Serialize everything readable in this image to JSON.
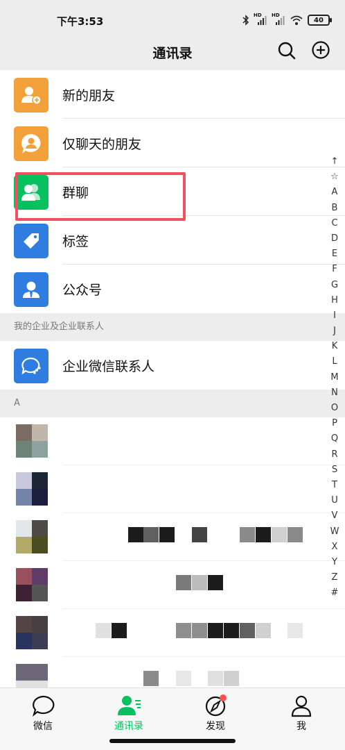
{
  "status_bar": {
    "time": "下午3:53",
    "battery": "40",
    "signal_labels": [
      "HD",
      "HD"
    ]
  },
  "header": {
    "title": "通讯录",
    "search_icon": "search-icon",
    "add_icon": "plus-circle-icon"
  },
  "entries": [
    {
      "label": "新的朋友",
      "icon": "add-friend-icon",
      "color": "#f2a13a"
    },
    {
      "label": "仅聊天的朋友",
      "icon": "chat-only-icon",
      "color": "#f2a13a"
    },
    {
      "label": "群聊",
      "icon": "group-chat-icon",
      "color": "#07c160"
    },
    {
      "label": "标签",
      "icon": "tag-icon",
      "color": "#2f7de1"
    },
    {
      "label": "公众号",
      "icon": "official-account-icon",
      "color": "#2f7de1"
    }
  ],
  "enterprise_section": {
    "header": "我的企业及企业联系人",
    "item_label": "企业微信联系人",
    "item_icon": "enterprise-wechat-icon",
    "color": "#2f7de1"
  },
  "contacts_section": {
    "header": "A",
    "contacts": [
      {
        "avatar_colors": [
          "#7a6c63",
          "#c0b6aa",
          "#6c8478",
          "#8ba39c"
        ]
      },
      {
        "avatar_colors": [
          "#c9c9de",
          "#1c2634",
          "#7385a8",
          "#1b1e3c"
        ]
      },
      {
        "avatar_colors": [
          "#e0e8ec",
          "#4c4c44",
          "#b4aa68",
          "#4c4c22"
        ]
      },
      {
        "avatar_colors": [
          "#98505c",
          "#603c68",
          "#402034",
          "#545454"
        ]
      },
      {
        "avatar_colors": [
          "#544444",
          "#484040",
          "#283460",
          "#3c3c54"
        ]
      },
      {
        "avatar_colors": [
          "#6c6878",
          "#6c6878",
          "#e0e0e0",
          "#e0e0e0"
        ]
      }
    ]
  },
  "alphabet_index": [
    "↑",
    "☆",
    "A",
    "B",
    "C",
    "D",
    "E",
    "F",
    "G",
    "H",
    "I",
    "J",
    "K",
    "L",
    "M",
    "N",
    "O",
    "P",
    "Q",
    "R",
    "S",
    "T",
    "U",
    "V",
    "W",
    "X",
    "Y",
    "Z",
    "#"
  ],
  "tabs": [
    {
      "label": "微信",
      "icon": "chat-bubble-icon",
      "active": false
    },
    {
      "label": "通讯录",
      "icon": "contacts-icon",
      "active": true
    },
    {
      "label": "发现",
      "icon": "compass-icon",
      "active": false,
      "badge": true
    },
    {
      "label": "我",
      "icon": "person-icon",
      "active": false
    }
  ],
  "colors": {
    "accent": "#07c160",
    "highlight": "#f05060",
    "badge": "#fa5151"
  }
}
